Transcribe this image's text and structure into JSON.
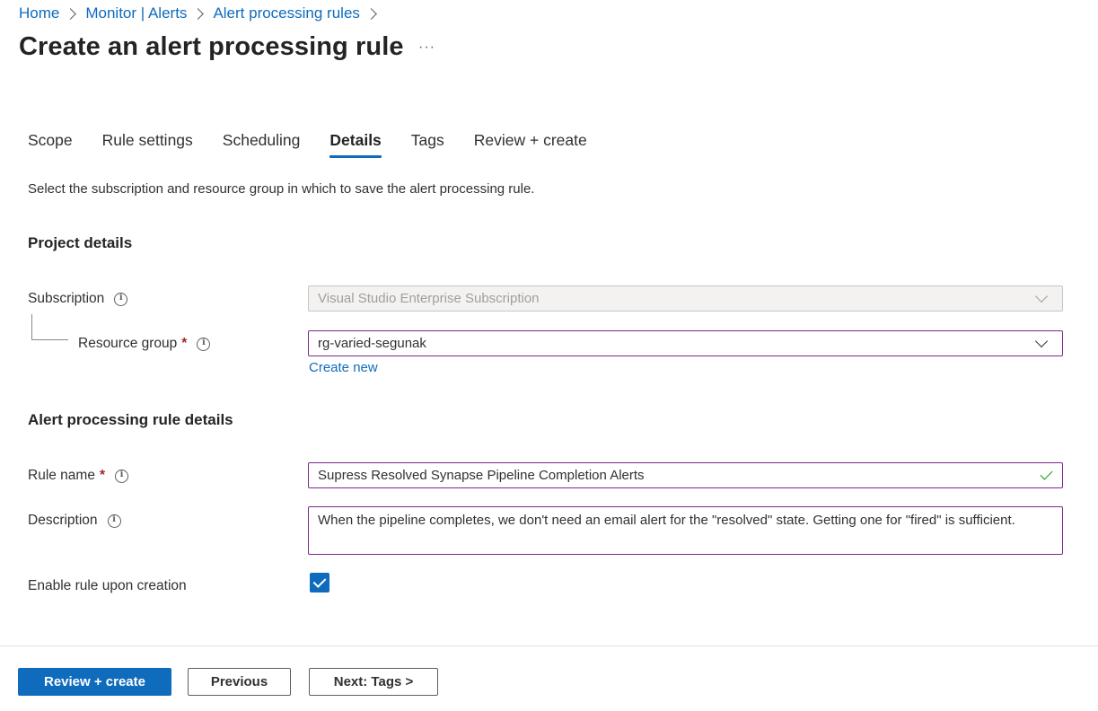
{
  "breadcrumb": {
    "items": [
      "Home",
      "Monitor | Alerts",
      "Alert processing rules"
    ]
  },
  "page": {
    "title": "Create an alert processing rule",
    "more_label": "···"
  },
  "tabs": [
    {
      "label": "Scope",
      "active": false
    },
    {
      "label": "Rule settings",
      "active": false
    },
    {
      "label": "Scheduling",
      "active": false
    },
    {
      "label": "Details",
      "active": true
    },
    {
      "label": "Tags",
      "active": false
    },
    {
      "label": "Review + create",
      "active": false
    }
  ],
  "intro": "Select the subscription and resource group in which to save the alert processing rule.",
  "project_details": {
    "heading": "Project details",
    "subscription": {
      "label": "Subscription",
      "value": "Visual Studio Enterprise Subscription"
    },
    "resource_group": {
      "label": "Resource group",
      "required_mark": "*",
      "value": "rg-varied-segunak",
      "create_new_label": "Create new"
    }
  },
  "rule_details": {
    "heading": "Alert processing rule details",
    "rule_name": {
      "label": "Rule name",
      "required_mark": "*",
      "value": "Supress Resolved Synapse Pipeline Completion Alerts"
    },
    "description": {
      "label": "Description",
      "value": "When the pipeline completes, we don't need an email alert for the \"resolved\" state. Getting one for \"fired\" is sufficient."
    },
    "enable": {
      "label": "Enable rule upon creation",
      "checked": true
    }
  },
  "footer": {
    "review_create_label": "Review + create",
    "previous_label": "Previous",
    "next_label": "Next: Tags >"
  },
  "colors": {
    "accent": "#0f6cbd",
    "focus_border": "#7b2a8a",
    "required": "#a4262c",
    "valid": "#13a10e"
  }
}
